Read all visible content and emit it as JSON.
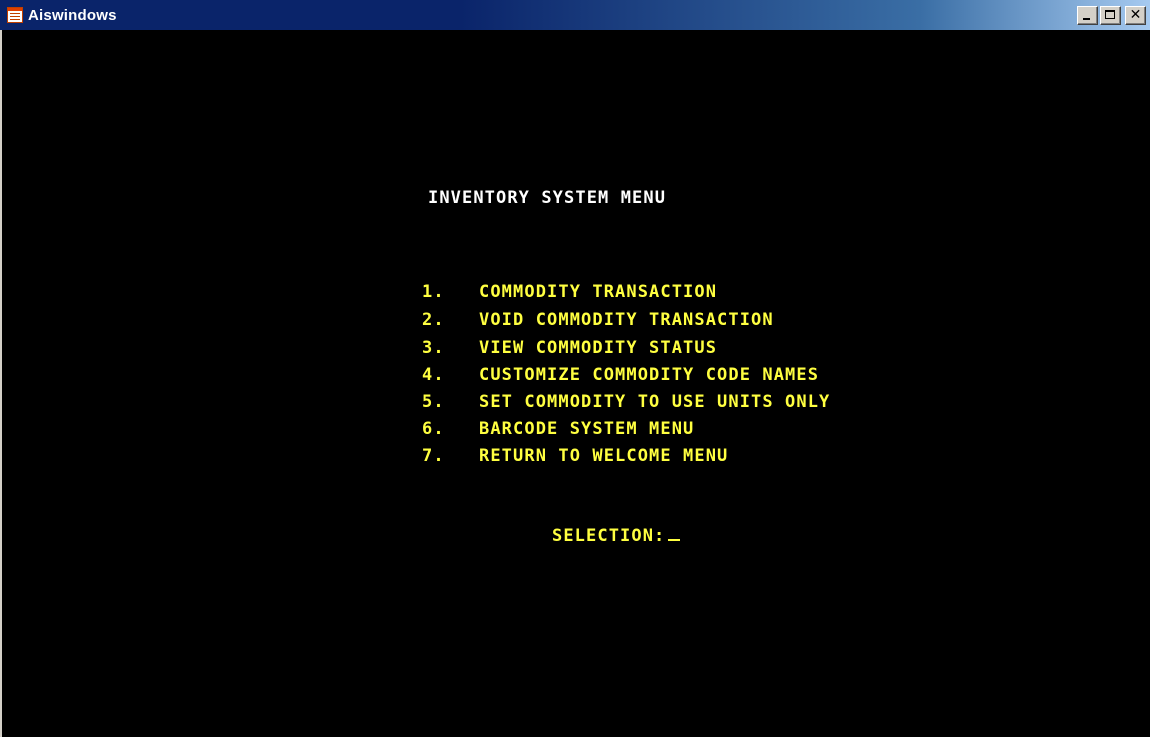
{
  "window": {
    "title": "Aiswindows",
    "buttons": {
      "minimize": "minimize-icon",
      "maximize": "maximize-icon",
      "close": "close-icon"
    }
  },
  "terminal": {
    "menu_title": "INVENTORY SYSTEM MENU",
    "items": [
      {
        "number": "1.",
        "label": "COMMODITY TRANSACTION"
      },
      {
        "number": "2.",
        "label": "VOID COMMODITY TRANSACTION"
      },
      {
        "number": "3.",
        "label": "VIEW COMMODITY STATUS"
      },
      {
        "number": "4.",
        "label": "CUSTOMIZE COMMODITY CODE NAMES"
      },
      {
        "number": "5.",
        "label": "SET COMMODITY TO USE UNITS ONLY"
      },
      {
        "number": "6.",
        "label": "BARCODE SYSTEM MENU"
      },
      {
        "number": "7.",
        "label": "RETURN TO WELCOME MENU"
      }
    ],
    "selection_label": "SELECTION:",
    "selection_value": ""
  },
  "colors": {
    "terminal_bg": "#000000",
    "terminal_text": "#ffff40",
    "title_text": "#ffffff",
    "titlebar": "#0a246a"
  }
}
